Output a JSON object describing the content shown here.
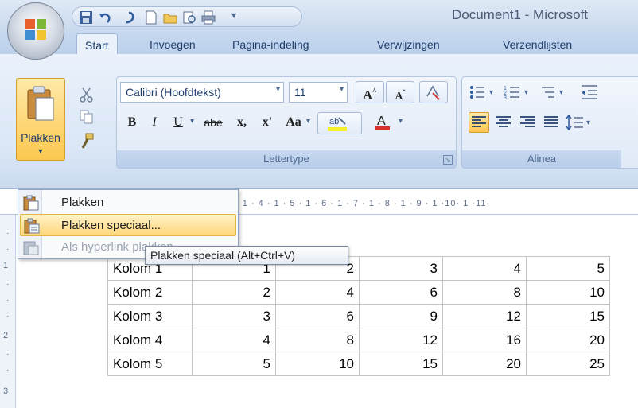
{
  "window": {
    "title": "Document1 - Microsoft"
  },
  "tabs": [
    {
      "label": "Start"
    },
    {
      "label": "Invoegen"
    },
    {
      "label": "Pagina-indeling"
    },
    {
      "label": "Verwijzingen"
    },
    {
      "label": "Verzendlijsten"
    }
  ],
  "clipboard": {
    "paste_label": "Plakken"
  },
  "font_group": {
    "label": "Lettertype",
    "font_name": "Calibri (Hoofdtekst)",
    "font_size": "11",
    "bold": "B",
    "italic": "I",
    "underline": "U",
    "strike": "abe",
    "subscript": "x,",
    "superscript": "x'",
    "change_case": "Aa",
    "grow": "A",
    "shrink": "A"
  },
  "paragraph_group": {
    "label": "Alinea"
  },
  "paste_menu": {
    "items": [
      {
        "label": "Plakken",
        "enabled": true
      },
      {
        "label": "Plakken speciaal...",
        "enabled": true,
        "hover": true
      },
      {
        "label": "Als hyperlink plakken",
        "enabled": false
      }
    ],
    "tooltip": "Plakken speciaal (Alt+Ctrl+V)"
  },
  "ruler": {
    "text": "· 1 · 4 · 1 · 5 · 1 · 6 · 1 · 7 · 1 · 8 · 1 · 9 · 1 ·10· 1 ·11·"
  },
  "vertical_ruler": {
    "numbers": [
      "1",
      "2",
      "3"
    ]
  },
  "table": {
    "rows": [
      {
        "label": "Kolom 1",
        "values": [
          "1",
          "2",
          "3",
          "4",
          "5"
        ]
      },
      {
        "label": "Kolom 2",
        "values": [
          "2",
          "4",
          "6",
          "8",
          "10"
        ]
      },
      {
        "label": "Kolom 3",
        "values": [
          "3",
          "6",
          "9",
          "12",
          "15"
        ]
      },
      {
        "label": "Kolom 4",
        "values": [
          "4",
          "8",
          "12",
          "16",
          "20"
        ]
      },
      {
        "label": "Kolom 5",
        "values": [
          "5",
          "10",
          "15",
          "20",
          "25"
        ]
      }
    ]
  }
}
